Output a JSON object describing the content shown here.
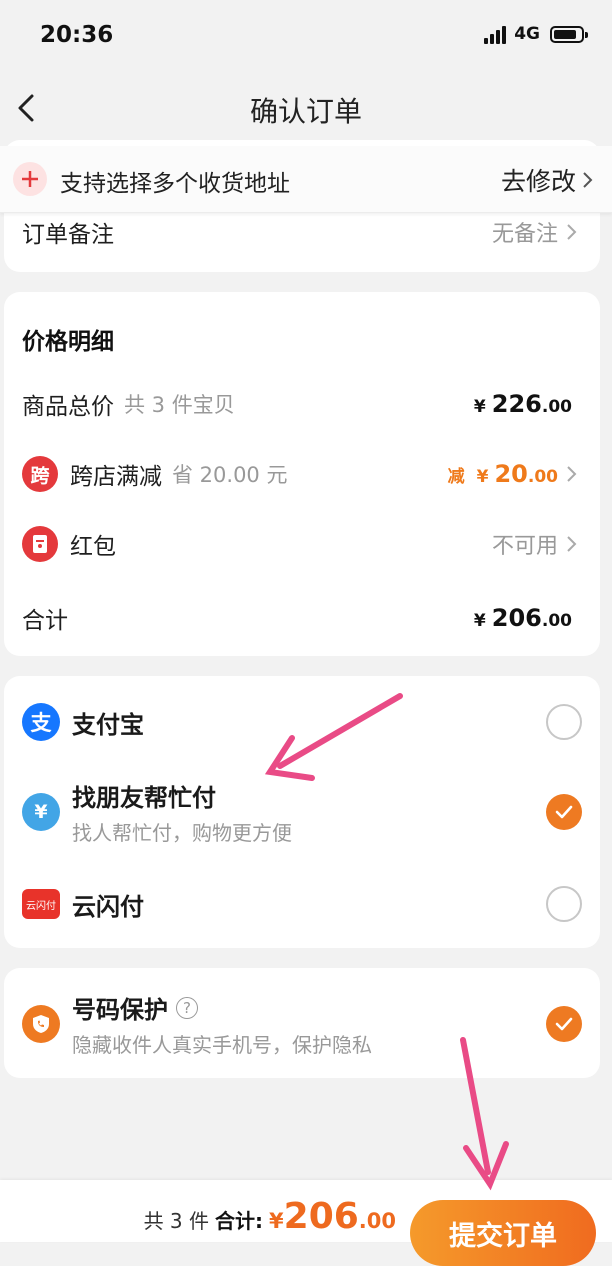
{
  "status_bar": {
    "time": "20:36",
    "network": "4G"
  },
  "nav": {
    "title": "确认订单"
  },
  "address_banner": {
    "text": "支持选择多个收货地址",
    "action": "去修改"
  },
  "order_note": {
    "label": "订单备注",
    "value": "无备注"
  },
  "price_detail": {
    "title": "价格明细",
    "goods_total": {
      "label": "商品总价",
      "sub": "共 3 件宝贝",
      "currency": "¥",
      "int": "226",
      "dec": ".00"
    },
    "cross_store": {
      "icon_text": "跨",
      "label": "跨店满减",
      "sub": "省 20.00 元",
      "prefix": "减",
      "currency": "¥",
      "int": "20",
      "dec": ".00"
    },
    "red_packet": {
      "label": "红包",
      "value": "不可用"
    },
    "subtotal": {
      "label": "合计",
      "currency": "¥",
      "int": "206",
      "dec": ".00"
    }
  },
  "payment": {
    "alipay": {
      "name": "支付宝",
      "icon_text": "支",
      "checked": false
    },
    "friend_pay": {
      "name": "找朋友帮忙付",
      "desc": "找人帮忙付，购物更方便",
      "icon_text": "¥",
      "checked": true
    },
    "union_pay": {
      "name": "云闪付",
      "icon_text": "云闪付",
      "checked": false
    }
  },
  "number_protect": {
    "name": "号码保护",
    "help": "?",
    "desc": "隐藏收件人真实手机号，保护隐私",
    "checked": true
  },
  "bottom": {
    "count": "共 3 件",
    "total_label": "合计:",
    "currency": "¥",
    "int": "206",
    "dec": ".00",
    "submit": "提交订单"
  },
  "colors": {
    "accent": "#ee7a22",
    "alipay": "#1677ff",
    "friend": "#42a5e6",
    "union": "#e8332a",
    "cross": "#e4393c",
    "arrow": "#e94b86"
  }
}
